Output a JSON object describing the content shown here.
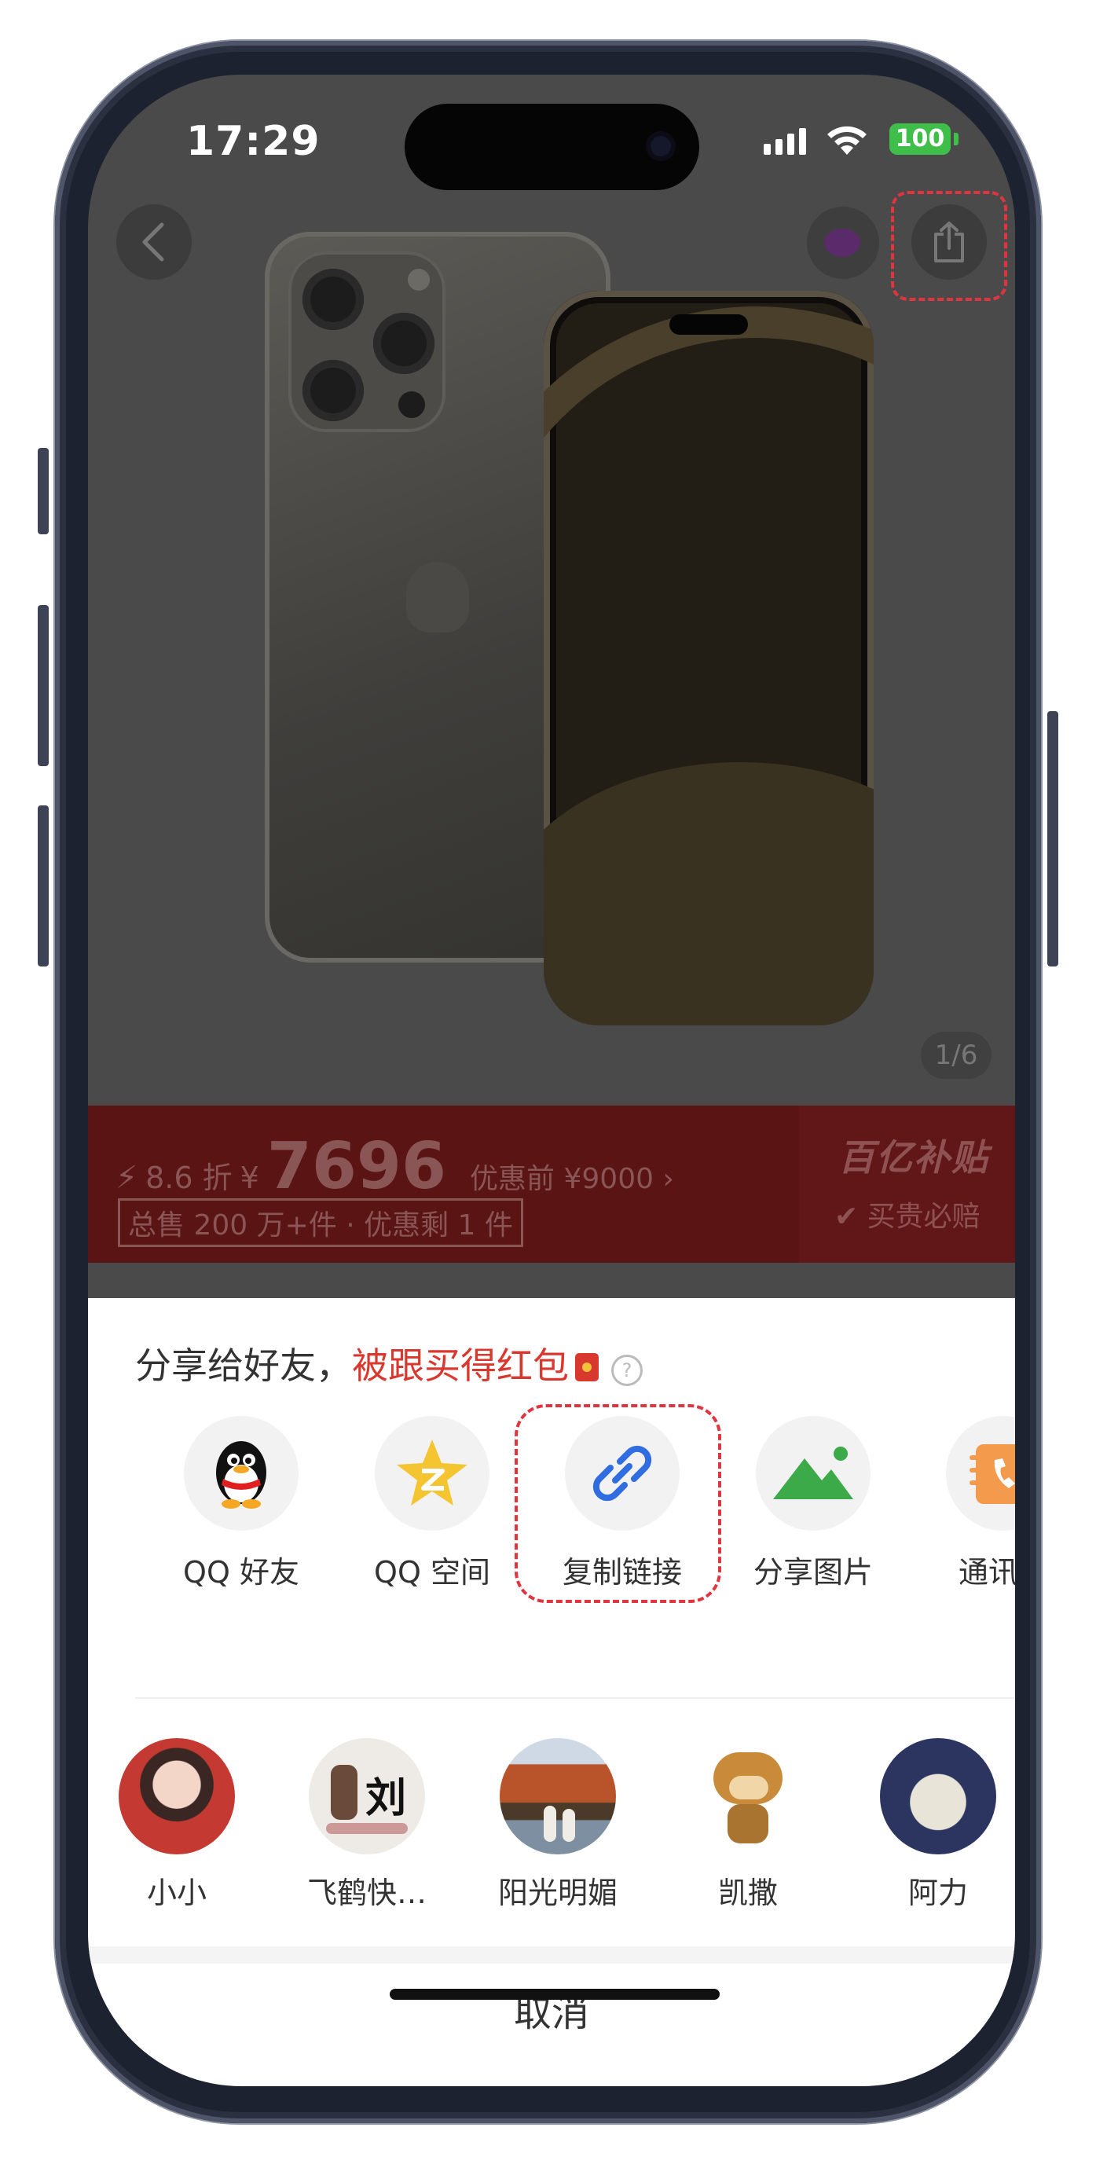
{
  "status_bar": {
    "time": "17:29",
    "battery": "100"
  },
  "product": {
    "page_indicator": "1/6"
  },
  "price_banner": {
    "discount": "8.6 折",
    "currency": "¥",
    "price": "7696",
    "original_price": "优惠前 ¥9000 ›",
    "sales_tag": "总售 200 万+件 · 优惠剩 1 件",
    "brand": "百亿补贴",
    "guarantee": "买贵必赔"
  },
  "share_sheet": {
    "title_prefix": "分享给好友，",
    "title_highlight": "被跟买得红包",
    "help": "?",
    "apps": [
      {
        "label": "QQ 好友",
        "icon": "qq-penguin-icon"
      },
      {
        "label": "QQ 空间",
        "icon": "qzone-star-icon"
      },
      {
        "label": "复制链接",
        "icon": "link-icon"
      },
      {
        "label": "分享图片",
        "icon": "image-mountain-icon"
      },
      {
        "label": "通讯录",
        "icon": "contacts-icon"
      }
    ],
    "friends": [
      {
        "name": "小小"
      },
      {
        "name": "飞鹤快…"
      },
      {
        "name": "阳光明媚"
      },
      {
        "name": "凯撒"
      },
      {
        "name": "阿力"
      }
    ],
    "cancel": "取消"
  },
  "colors": {
    "accent_red": "#d9382f",
    "highlight_dash": "#e0353f",
    "link_blue": "#2f6de0",
    "qzone_yellow": "#f4c531",
    "image_green": "#3daa49",
    "contacts_orange": "#f39a4c"
  }
}
